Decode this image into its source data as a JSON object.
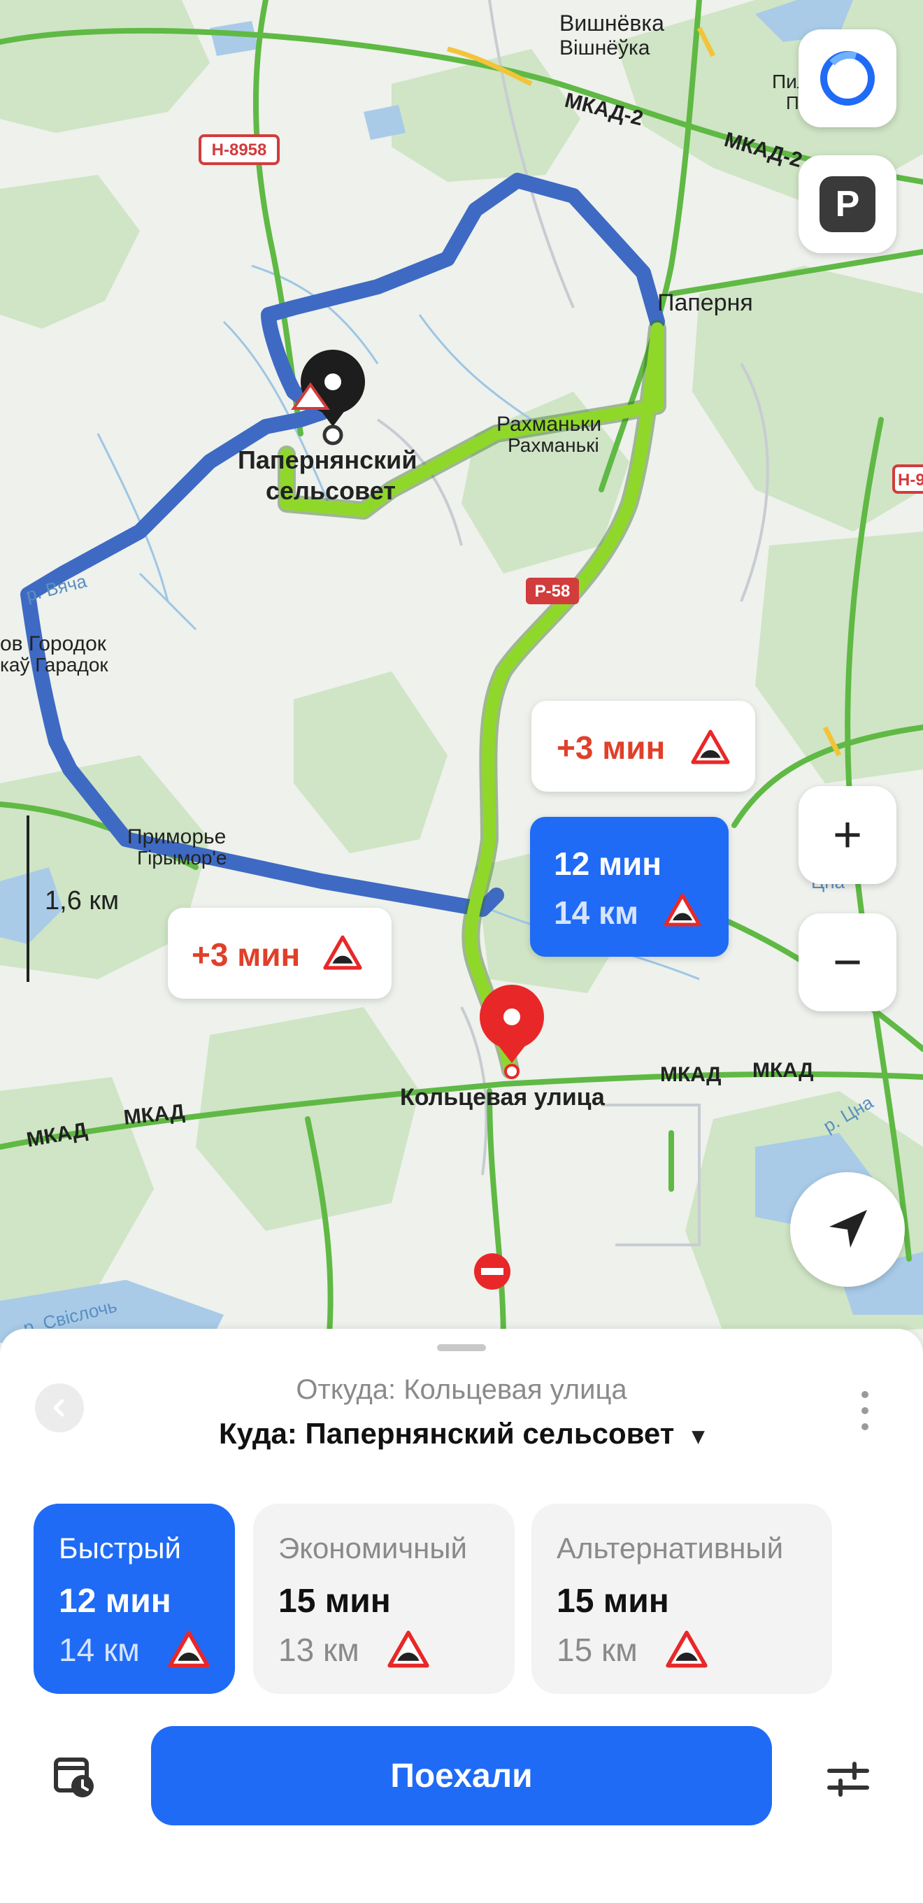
{
  "map": {
    "places": [
      {
        "text": "Вишнёвка"
      },
      {
        "text": "Вішнёўка"
      },
      {
        "text": "Паперня"
      },
      {
        "text": "Рахманьки"
      },
      {
        "text": "Рахманькі"
      },
      {
        "text": "Папернянский"
      },
      {
        "text": "сельсовет"
      },
      {
        "text": "ов Городок"
      },
      {
        "text": "каў Гарадок"
      },
      {
        "text": "Приморье"
      },
      {
        "text": "Гірымор'е"
      },
      {
        "text": "Кольцевая улица"
      },
      {
        "text": "Пилгн"
      },
      {
        "text": "Пілгн"
      },
      {
        "text": "р. Вяча"
      },
      {
        "text": "р. Свіслочь"
      },
      {
        "text": "р. Цна"
      },
      {
        "text": "Цна"
      }
    ],
    "roads": [
      {
        "text": "МКАД-2"
      },
      {
        "text": "МКАД-2"
      },
      {
        "text": "МКАД"
      },
      {
        "text": "МКАД"
      },
      {
        "text": "МКАД"
      },
      {
        "text": "МКАД"
      }
    ],
    "shields": [
      {
        "text": "Н-8958"
      },
      {
        "text": "Р-58"
      },
      {
        "text": "Н-9"
      }
    ],
    "scale_label": "1,6 км",
    "route_bubble": {
      "time": "12 мин",
      "dist": "14 км"
    },
    "alt_bubbles": [
      {
        "text": "+3 мин"
      },
      {
        "text": "+3 мин"
      }
    ],
    "colors": {
      "selected_route": "#8fd82a",
      "alt_route": "#3e6ac4",
      "accent": "#1f6bf5",
      "pin": "#e82828"
    }
  },
  "controls": {
    "alice_icon": "alice-icon",
    "parking_label": "P",
    "zoom_in": "+",
    "zoom_out": "−",
    "locate_icon": "navigation-arrow-icon"
  },
  "sheet": {
    "from": "Откуда: Кольцевая улица",
    "to": "Куда: Папернянский сельсовет",
    "to_caret": "▾",
    "options": [
      {
        "title": "Быстрый",
        "time": "12 мин",
        "dist": "14 км",
        "selected": true
      },
      {
        "title": "Экономичный",
        "time": "15 мин",
        "dist": "13 км",
        "selected": false
      },
      {
        "title": "Альтернативный",
        "time": "15 мин",
        "dist": "15 км",
        "selected": false
      }
    ],
    "go_label": "Поехали",
    "schedule_icon": "calendar-clock-icon",
    "settings_icon": "sliders-icon"
  }
}
